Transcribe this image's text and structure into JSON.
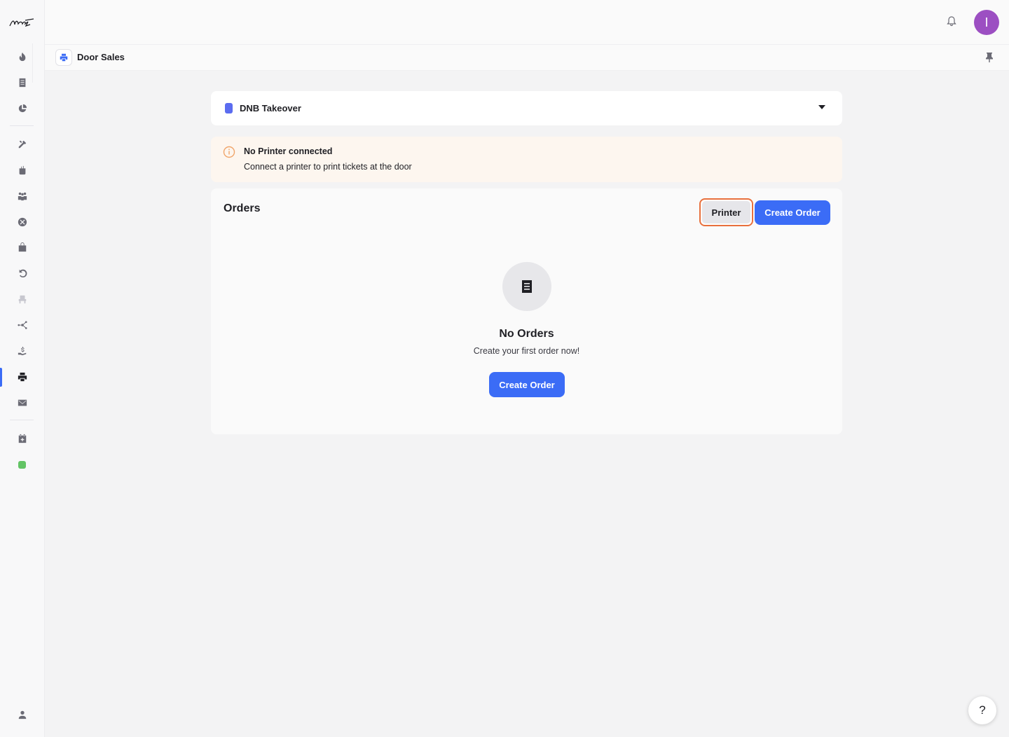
{
  "brand": {
    "logo_text": "Noise Z"
  },
  "sidebar": {
    "items": [
      {
        "name": "sidebar-item-trending",
        "icon": "flame-icon"
      },
      {
        "name": "sidebar-item-events",
        "icon": "document-icon"
      },
      {
        "name": "sidebar-item-analytics",
        "icon": "pie-chart-icon"
      },
      {
        "name": "sidebar-item-tools",
        "icon": "tools-icon"
      },
      {
        "name": "sidebar-item-bar",
        "icon": "drink-icon"
      },
      {
        "name": "sidebar-item-team",
        "icon": "people-icon"
      },
      {
        "name": "sidebar-item-cancel",
        "icon": "cancel-icon"
      },
      {
        "name": "sidebar-item-shop",
        "icon": "bag-icon"
      },
      {
        "name": "sidebar-item-refunds",
        "icon": "undo-icon"
      },
      {
        "name": "sidebar-item-seating",
        "icon": "seat-icon"
      },
      {
        "name": "sidebar-item-integrations",
        "icon": "network-icon"
      },
      {
        "name": "sidebar-item-payouts",
        "icon": "payout-icon"
      },
      {
        "name": "sidebar-item-door-sales",
        "icon": "printer-icon",
        "active": true
      },
      {
        "name": "sidebar-item-mail",
        "icon": "mail-icon"
      },
      {
        "name": "sidebar-item-calendar",
        "icon": "calendar-plus-icon"
      },
      {
        "name": "sidebar-item-status",
        "icon": "status-dot-icon"
      },
      {
        "name": "sidebar-item-account",
        "icon": "user-icon"
      }
    ],
    "accent_color": "#3b6cf6",
    "status_color": "#63c465"
  },
  "topbar": {
    "avatar_initial": "I",
    "avatar_color": "#9c4fc2"
  },
  "page": {
    "title": "Door Sales"
  },
  "event_select": {
    "selected": "DNB Takeover",
    "color": "#5b6cf0"
  },
  "alert": {
    "title": "No Printer connected",
    "body": "Connect a printer to print tickets at the door",
    "color": "#f0a56a"
  },
  "orders": {
    "title": "Orders",
    "printer_label": "Printer",
    "create_label": "Create Order",
    "empty_title": "No Orders",
    "empty_subtitle": "Create your first order now!",
    "empty_create_label": "Create Order"
  },
  "help": {
    "label": "?"
  }
}
